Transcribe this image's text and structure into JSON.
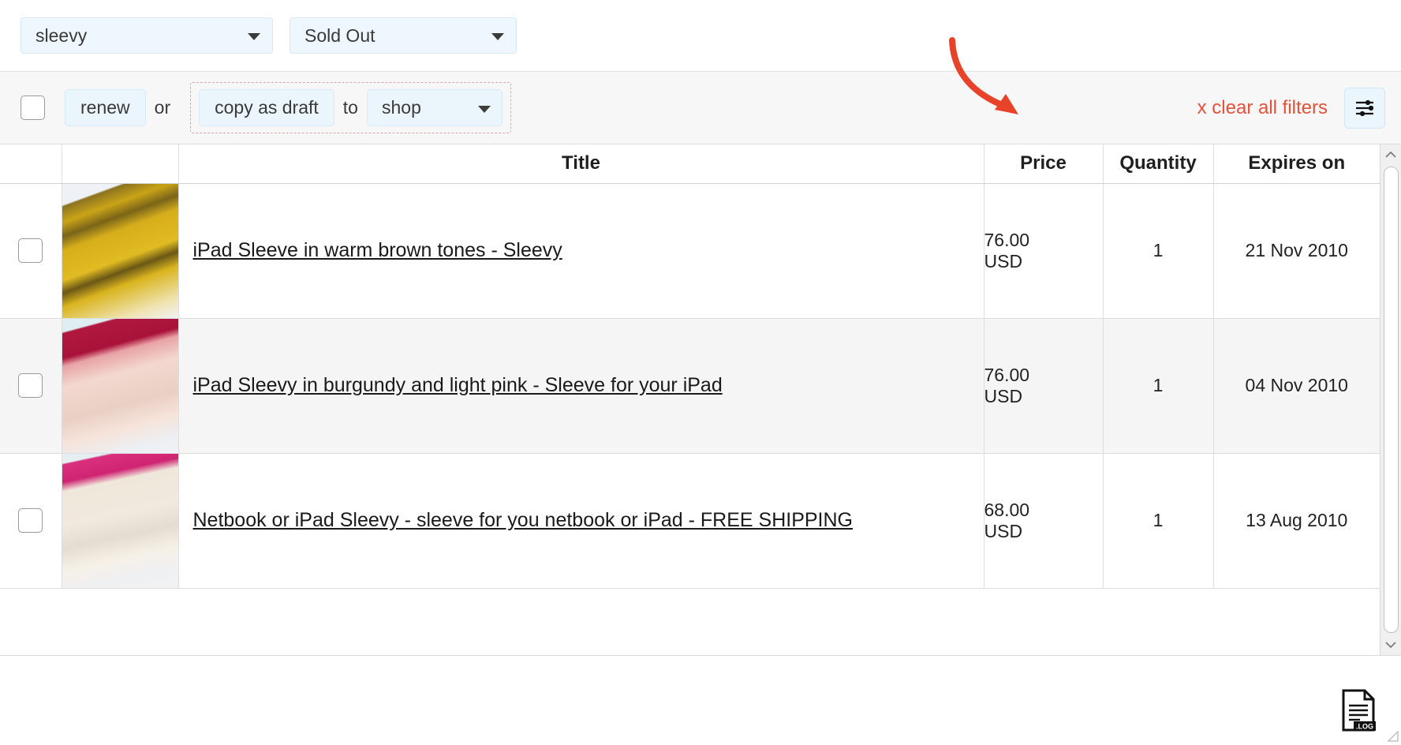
{
  "filters": {
    "keyword_select": {
      "value": "sleevy",
      "icon": "chevron-down-icon"
    },
    "status_select": {
      "value": "Sold Out",
      "icon": "chevron-down-icon"
    }
  },
  "toolbar": {
    "select_all_checkbox": "",
    "renew_label": "renew",
    "or_label": "or",
    "copy_as_draft_label": "copy as draft",
    "to_label": "to",
    "shop_select_value": "shop",
    "clear_all_filters_label": "x clear all filters",
    "filter_settings_icon": "sliders-icon",
    "accent_color": "#e8503a",
    "button_bg": "#eaf5fc"
  },
  "table": {
    "headers": {
      "check": "",
      "image": "",
      "title": "Title",
      "price": "Price",
      "quantity": "Quantity",
      "expires": "Expires on"
    },
    "rows": [
      {
        "title": "iPad Sleeve in warm brown tones - Sleevy",
        "price_amount": "76.00",
        "price_currency": "USD",
        "quantity": "1",
        "expires": "21 Nov 2010",
        "thumb_alt": "mustard-yellow-knitted-ipad-sleeve"
      },
      {
        "title": "iPad Sleevy in burgundy and light pink - Sleeve for your iPad",
        "price_amount": "76.00",
        "price_currency": "USD",
        "quantity": "1",
        "expires": "04 Nov 2010",
        "thumb_alt": "burgundy-and-light-pink-knitted-sleeve"
      },
      {
        "title": "Netbook or iPad Sleevy - sleeve for you netbook or iPad - FREE SHIPPING",
        "price_amount": "68.00",
        "price_currency": "USD",
        "quantity": "1",
        "expires": "13 Aug 2010",
        "thumb_alt": "pink-and-cream-knitted-netbook-sleeve"
      }
    ]
  },
  "scrollbar": {
    "up_arrow_icon": "chevron-up-icon",
    "down_arrow_icon": "chevron-down-icon"
  },
  "footer": {
    "log_file_icon": "log-file-icon",
    "log_label": ".LOG"
  }
}
